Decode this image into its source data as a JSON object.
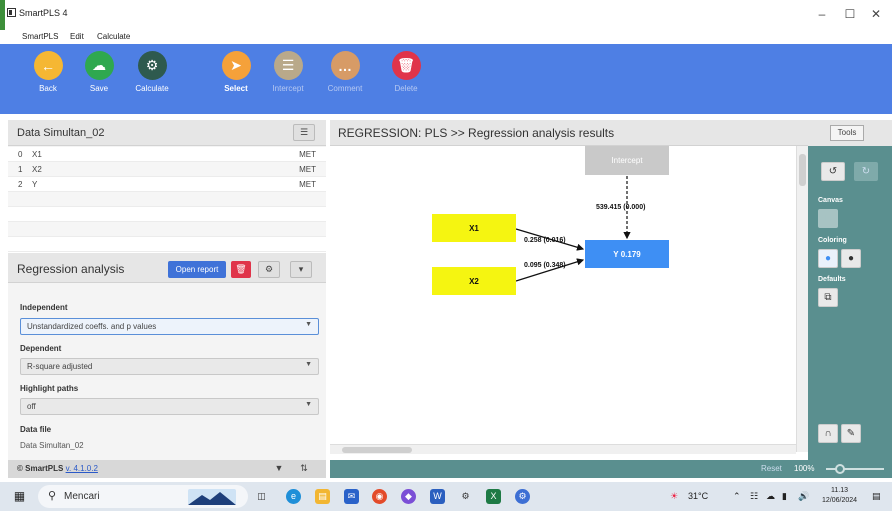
{
  "window": {
    "title": "SmartPLS 4",
    "minimize": "–",
    "maximize": "☐",
    "close": "✕"
  },
  "menu": [
    "SmartPLS",
    "Edit",
    "Calculate"
  ],
  "toolbar": {
    "back": "Back",
    "save": "Save",
    "calculate": "Calculate",
    "select": "Select",
    "intercept": "Intercept",
    "comment": "Comment",
    "delete": "Delete"
  },
  "data_panel": {
    "title": "Data Simultan_02",
    "variables": [
      {
        "index": "0",
        "name": "X1",
        "type": "MET"
      },
      {
        "index": "1",
        "name": "X2",
        "type": "MET"
      },
      {
        "index": "2",
        "name": "Y",
        "type": "MET"
      }
    ]
  },
  "regression_panel": {
    "title": "Regression analysis",
    "open_report": "Open report",
    "independent_label": "Independent",
    "independent_value": "Unstandardized coeffs. and p values",
    "dependent_label": "Dependent",
    "dependent_value": "R-square adjusted",
    "highlight_label": "Highlight paths",
    "highlight_value": "off",
    "datafile_label": "Data file",
    "datafile_value": "Data Simultan_02"
  },
  "footer": {
    "copyright": "© SmartPLS",
    "version": "v. 4.1.0.2"
  },
  "canvas": {
    "title": "REGRESSION: PLS >> Regression analysis results",
    "nodes": {
      "intercept": "Intercept",
      "x1": "X1",
      "x2": "X2",
      "y": "Y  0.179"
    },
    "edges": {
      "intercept_y": "539.415 (0.000)",
      "x1_y": "0.258 (0.016)",
      "x2_y": "0.095 (0.348)"
    }
  },
  "tools_panel": {
    "button": "Tools",
    "canvas": "Canvas",
    "coloring": "Coloring",
    "defaults": "Defaults"
  },
  "status": {
    "reset": "Reset",
    "zoom": "100%"
  },
  "taskbar": {
    "search": "Mencari",
    "temperature": "31°C",
    "time": "11.13",
    "date": "12/06/2024"
  }
}
